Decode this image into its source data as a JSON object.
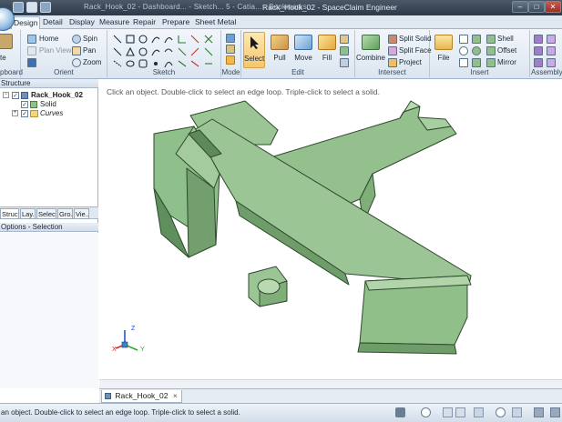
{
  "titlebar": {
    "taskbar_text": "Rack_Hook_02 - Dashboard... - Sketch... 5 - Catia... - Bookmarks...",
    "title": "Rack_Hook_02 - SpaceClaim Engineer",
    "min": "–",
    "max": "□",
    "close": "✕"
  },
  "tabs": [
    "Design",
    "Detail",
    "Display",
    "Measure",
    "Repair",
    "Prepare",
    "Sheet Metal"
  ],
  "ribbon": {
    "clipboard": {
      "paste": "te",
      "label": "pboard"
    },
    "orient": {
      "home": "Home",
      "plan_view": "Plan View",
      "spin": "Spin",
      "pan": "Pan",
      "zoom": "Zoom",
      "label": "Orient"
    },
    "sketch": {
      "label": "Sketch"
    },
    "mode": {
      "label": "Mode"
    },
    "edit": {
      "select": "Select",
      "pull": "Pull",
      "move": "Move",
      "fill": "Fill",
      "label": "Edit"
    },
    "intersect": {
      "combine": "Combine",
      "split_solid": "Split Solid",
      "split_face": "Split Face",
      "project": "Project",
      "label": "Intersect"
    },
    "insert": {
      "file": "File",
      "shell": "Shell",
      "offset": "Offset",
      "mirror": "Mirror",
      "label": "Insert"
    },
    "assembly": {
      "label": "Assembly"
    }
  },
  "structure": {
    "header": "Structure",
    "root": "Rack_Hook_02",
    "children": [
      "Solid",
      "Curves"
    ],
    "bottom_tabs": [
      "Struct...",
      "Lay...",
      "Select...",
      "Gro...",
      "Vie..."
    ]
  },
  "options": {
    "header": "Options - Selection"
  },
  "viewport": {
    "hint": "Click an object. Double-click to select an edge loop. Triple-click to select a solid.",
    "triad_z": "Z",
    "triad_y": "Y",
    "triad_x": "X"
  },
  "document_tab": {
    "label": "Rack_Hook_02",
    "close": "×"
  },
  "status": {
    "text": "an object. Double-click to select an edge loop. Triple-click to select a solid."
  },
  "colors": {
    "part_face": "#8fbf8a",
    "part_dark": "#5f8f5c",
    "ribbon_bg": "#dbe5f0",
    "accent": "#4a7fb5"
  }
}
